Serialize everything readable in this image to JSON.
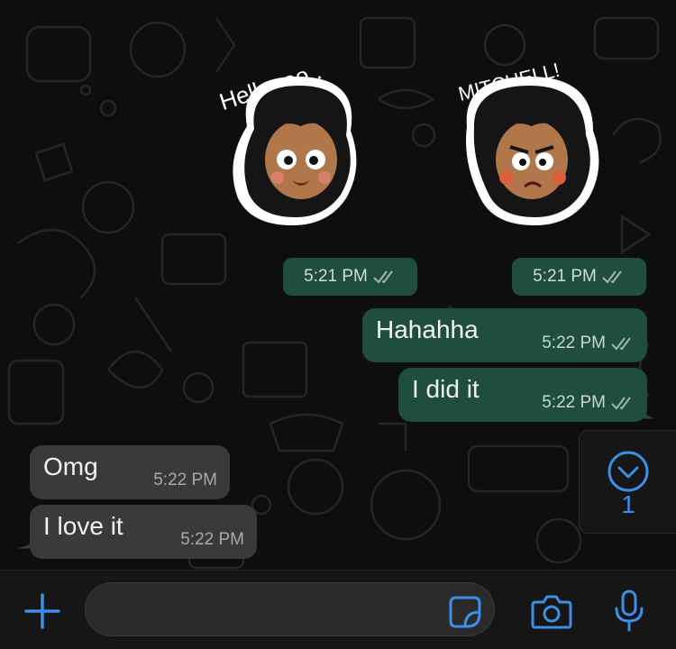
{
  "messages": [
    {
      "type": "sticker",
      "direction": "out",
      "sticker_icon": "hello-boy-sticker-icon",
      "time": "5:21 PM",
      "status": "read"
    },
    {
      "type": "sticker",
      "direction": "out",
      "sticker_icon": "angry-mitchell-sticker-icon",
      "time": "5:21 PM",
      "status": "read"
    },
    {
      "type": "text",
      "direction": "out",
      "text": "Hahahha",
      "time": "5:22 PM",
      "status": "read"
    },
    {
      "type": "text",
      "direction": "out",
      "text": "I did it",
      "time": "5:22 PM",
      "status": "read"
    },
    {
      "type": "text",
      "direction": "in",
      "text": "Omg",
      "time": "5:22 PM"
    },
    {
      "type": "text",
      "direction": "in",
      "text": "I love it",
      "time": "5:22 PM"
    }
  ],
  "stickers": {
    "hello_text": "Helloooo..",
    "mitchell_text": "MITCHELL!"
  },
  "scroll_down": {
    "unread_count": "1",
    "icon": "chevron-down-circle-icon"
  },
  "composer": {
    "placeholder": "",
    "icons": [
      "plus-icon",
      "sticker-icon",
      "camera-icon",
      "microphone-icon"
    ]
  },
  "colors": {
    "outgoing_bubble": "#1f4d3f",
    "incoming_bubble": "#3a3a3a",
    "accent": "#3b8fe8",
    "background": "#0e0e0e"
  }
}
